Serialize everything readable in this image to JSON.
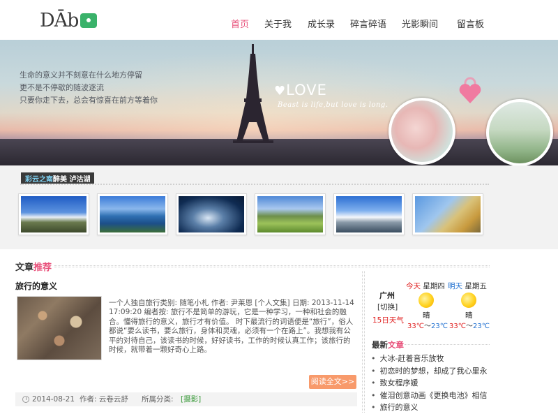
{
  "header": {
    "logo_text": "DĀb",
    "nav": [
      {
        "label": "首页",
        "active": true
      },
      {
        "label": "关于我",
        "active": false
      },
      {
        "label": "成长录",
        "active": false
      },
      {
        "label": "碎言碎语",
        "active": false
      },
      {
        "label": "光影瞬间",
        "active": false
      },
      {
        "label": "留言板",
        "active": false
      }
    ]
  },
  "banner": {
    "quote_lines": [
      "生命的意义并不刻意在什么地方停留",
      "更不是不停歇的随波逐流",
      "只要你走下去，总会有惊喜在前方等着你"
    ],
    "love": "LOVE",
    "script": "Beast is life,but love is long."
  },
  "gallery": {
    "title_highlight": "彩云之南",
    "title_rest": "醉美 泸沽湖"
  },
  "articles": {
    "section_title_a": "文章",
    "section_title_b": "推荐",
    "title": "旅行的意义",
    "summary": "一个人独自旅行类别: 随笔小札    作者: 尹莱恩 [个人文集]    日期: 2013-11-14 17:09:20 编者按: 旅行不是简单的游玩，它是一种学习，一种和社会的融合。懂得旅行的意义，旅行才有价值。      时下最流行的词语便是“旅行”，俗人都说“要么读书，要么旅行，身体和灵魂，必须有一个在路上”。我想我有公平的对待自己，该读书的时候，好好读书，工作的时候认真工作；该旅行的时候，就带着一颗好奇心上路。",
    "read_more": "阅读全文>>",
    "meta_date": "2014-08-21",
    "meta_author": "作者: 云卷云舒",
    "meta_cat_label": "所属分类:",
    "meta_cat": "[摄影]"
  },
  "weather": {
    "city": "广州",
    "toggle": "[切换]",
    "forecast": "15日天气",
    "day1_prefix": "今天",
    "day1_name": "星期四",
    "day1_cond": "晴",
    "day1_high": "33℃",
    "day1_sep": "～",
    "day1_low": "23℃",
    "day2_prefix": "明天",
    "day2_name": "星期五",
    "day2_cond": "晴",
    "day2_high": "33℃",
    "day2_sep": "～",
    "day2_low": "23℃"
  },
  "latest": {
    "title_a": "最新",
    "title_b": "文章",
    "items": [
      "大冰-赶着音乐放牧",
      "初恋时的梦想，却成了我心里永",
      "致女程序媛",
      "催泪创意动画《更换电池》相信",
      "旅行的意义"
    ]
  }
}
